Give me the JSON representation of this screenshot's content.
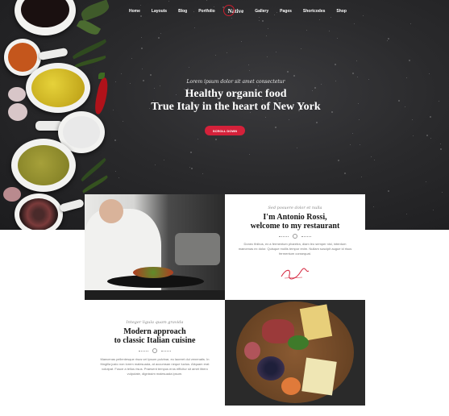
{
  "nav": {
    "items_left": [
      "Home",
      "Layouts",
      "Blog",
      "Portfolio"
    ],
    "logo": "Native",
    "items_right": [
      "Gallery",
      "Pages",
      "Shortcodes",
      "Shop"
    ]
  },
  "hero": {
    "script": "Lorem ipsum dolor sit amet consectetur",
    "title_line1": "Healthy organic food",
    "title_line2": "True Italy in the heart of New York",
    "button": "SCROLL DOWN"
  },
  "about": {
    "script": "Sed posuere dolor et nulla",
    "title_line1": "I'm Antonio Rossi,",
    "title_line2": "welcome to my restaurant",
    "paragraph": "Donec finibus, ex a fermentum pharetra, diam leo semper nisl, interdum maecenas ex dolor. Quisque mollis tempor enim. Nullam suscipit augue id risus fermentum consequat."
  },
  "approach": {
    "script": "Integer ligula quam gravida",
    "title_line1": "Modern approach",
    "title_line2": "to classic Italian cuisine",
    "paragraph": "Maecenas pellentesque risus vel ipsum pulvinar, eu laoreet dui venenatis. In fringilla justo non lorem malesuada, at accumsan neque luctus. Aliquam erat volutpat. Fusce a tellus risus. Praesent tempus eros efficitur sit amet libero vulputate, dignissim malesuada ipsum."
  },
  "colors": {
    "accent": "#d4213a",
    "hero_bg": "#2a2a2c"
  }
}
